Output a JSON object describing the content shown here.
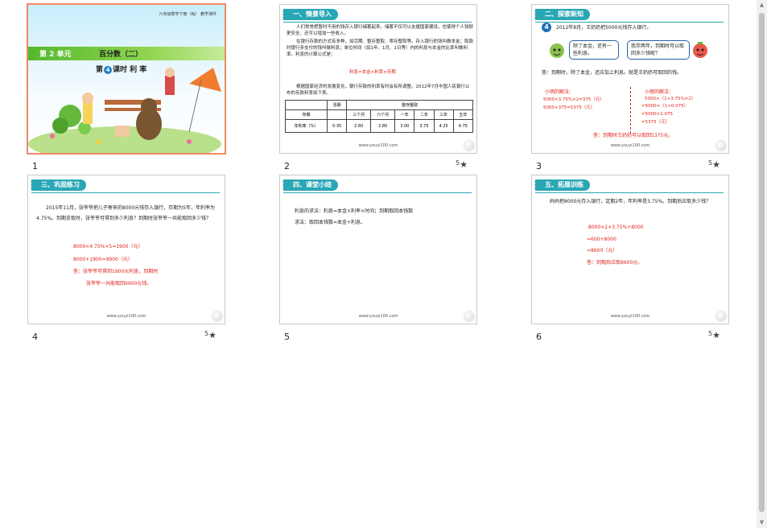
{
  "slides": [
    {
      "num": "1",
      "title_top": "六年级数学下册（RJ）  教学课件",
      "unit": "第 2 单元",
      "unit_title": "百分数（二）",
      "lesson_prefix": "第",
      "lesson_num": "4",
      "lesson_suffix": "课时  利  率"
    },
    {
      "num": "2",
      "header": "一、情景导入",
      "para1": "人们常常把暂时不用的钱存入银行储蓄起来。储蓄不仅可以支援国家建设，也使得个人钱财更安全，还可以增加一些收入。",
      "para2": "在银行存款的方式有多种，如活期、整存整取、零存整取等。存入银行的钱叫做本金；取款时银行多支付的钱叫做利息；单位时间（如1年、1月、1日等）内的利息与本金的比率叫做利率。利息的计算公式是：",
      "formula": "利息=本金×利率×存期",
      "para3": "根据国家经济的发展变化，银行存款的利率有时会有所调整。2012年7月中国人民银行公布的存款利率如下表。",
      "table": {
        "col_type": "",
        "current": "活期",
        "fixed": "整存整取",
        "row1": [
          "存期",
          "",
          "三个月",
          "六个月",
          "一年",
          "二年",
          "三年",
          "五年"
        ],
        "row2": [
          "年利率（%）",
          "0.35",
          "2.60",
          "2.80",
          "3.00",
          "3.75",
          "4.25",
          "4.75"
        ]
      },
      "footer": "www.youyi100.com"
    },
    {
      "num": "3",
      "header": "二、探索新知",
      "badge": "4",
      "question": "2012年8月，王奶奶把5000元钱存入银行。",
      "bubble1": "除了本金，还有一些利息。",
      "bubble2": "我存两年，到期时可以取回多少钱呢？",
      "answer_intro": "答：到期时，除了本金，还应加上利息。就是王奶奶可取回的钱。",
      "left_title": "小明的解法：",
      "left_lines": [
        "5000×3.75%×2=375（元）",
        "5000+375=5375（元）"
      ],
      "right_title": "小丽的解法：",
      "right_lines": [
        "5000×（1+3.75%×2）",
        "=5000×（1+0.075）",
        "=5000×1.075",
        "=5375（元）"
      ],
      "final": "答：到期时王奶奶可以取回5375元。",
      "footer": "www.youyi100.com"
    },
    {
      "num": "4",
      "header": "三、巩固练习",
      "problem": "2015年11月，张爷爷把儿子寄来的8000元钱存入银行，存期为5年，年利率为4.75%。到期支取时，张爷爷可得到多少利息？到期时张爷爷一共能取回多少钱？",
      "lines": [
        "8000×4.75%×5=1900（元）",
        "8000+1900=9900（元）",
        "答：张爷爷可得到1900元利息，到期时",
        "张爷爷一共能取回9900元钱。"
      ],
      "footer": "www.youyi100.com"
    },
    {
      "num": "5",
      "header": "四、课堂小结",
      "text1": "利息的求法：利息=本金×利率×时间；到期取回本钱数",
      "text2": "求法：取回本钱数=本金+利息。",
      "footer": "www.youyi100.com"
    },
    {
      "num": "6",
      "header": "五、拓展训练",
      "problem": "妈妈把8000元存入银行，定期2年，年利率是3.75%。到期后应取多少钱？",
      "lines": [
        "8000×2×3.75%+8000",
        "=600+8000",
        "=8600（元）",
        "答：到期后应取8600元。"
      ],
      "footer": "www.youyi100.com"
    }
  ],
  "star_label": "5"
}
